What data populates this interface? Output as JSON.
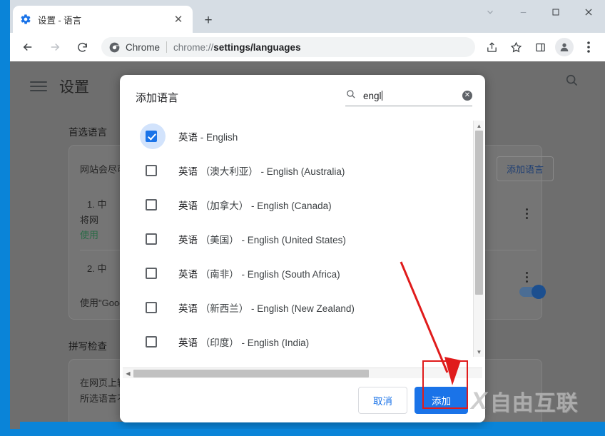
{
  "browser": {
    "tab": {
      "title": "设置 - 语言",
      "favicon": "settings-gear-icon",
      "close_label": "✕"
    },
    "new_tab_label": "+",
    "window_controls": {
      "tab_search": "⌄",
      "minimize": "—",
      "maximize": "▢",
      "close": "✕"
    },
    "toolbar": {
      "back": "←",
      "forward": "→",
      "reload": "⟳",
      "omnibox_brand": "Chrome",
      "omnibox_url_prefix": "chrome://",
      "omnibox_url_bold": "settings/languages",
      "share_icon": "share-icon",
      "bookmark_icon": "star-icon",
      "side_panel_icon": "side-panel-icon",
      "profile_icon": "avatar-icon",
      "menu_icon": "three-dot-menu-icon"
    }
  },
  "settings_page": {
    "menu_icon": "hamburger-icon",
    "title": "设置",
    "search_icon": "search-icon",
    "section_preferred_languages": "首选语言",
    "card_intro": "网站会尽可",
    "item_1": "1. 中",
    "item_1_line2": "将网",
    "item_1_line3": "使用",
    "item_2": "2. 中",
    "google_translate": "使用\"Googl",
    "add_language_button": "添加语言",
    "section_spellcheck": "拼写检查",
    "spellcheck_line1": "在网页上输",
    "spellcheck_line2": "所选语言不",
    "toggle_state": "on"
  },
  "dialog": {
    "title": "添加语言",
    "search": {
      "icon": "search-icon",
      "value": "engl",
      "clear_label": "✕"
    },
    "languages": [
      {
        "zh": "英语",
        "region": "",
        "en": "- English",
        "checked": true
      },
      {
        "zh": "英语",
        "region": "（澳大利亚）",
        "en": "- English (Australia)",
        "checked": false
      },
      {
        "zh": "英语",
        "region": "（加拿大）",
        "en": "- English (Canada)",
        "checked": false
      },
      {
        "zh": "英语",
        "region": "（美国）",
        "en": "- English (United States)",
        "checked": false
      },
      {
        "zh": "英语",
        "region": "（南非）",
        "en": "- English (South Africa)",
        "checked": false
      },
      {
        "zh": "英语",
        "region": "（新西兰）",
        "en": "- English (New Zealand)",
        "checked": false
      },
      {
        "zh": "英语",
        "region": "（印度）",
        "en": "- English (India)",
        "checked": false
      }
    ],
    "cancel_button": "取消",
    "add_button": "添加"
  },
  "watermark": {
    "logo": "X",
    "text": "自由互联"
  },
  "colors": {
    "accent": "#1a73e8",
    "annotation": "#e01b1b",
    "desktop": "#0a84d8",
    "page_dim": "#6e6e6e"
  }
}
